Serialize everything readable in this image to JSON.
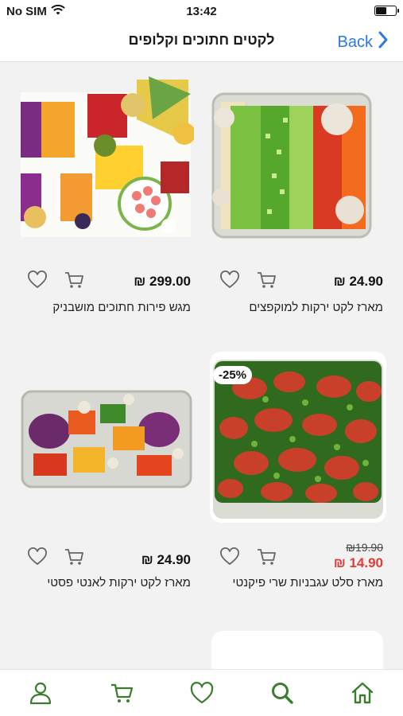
{
  "status": {
    "carrier": "No SIM",
    "time": "13:42",
    "battery_level": 0.55
  },
  "nav": {
    "title": "לקטים חתוכים וקלופים",
    "back_label": "Back"
  },
  "colors": {
    "accent_green": "#3a7d2e",
    "back_blue": "#2a7ae2",
    "sale_red": "#e53935"
  },
  "currency_symbol": "₪",
  "products": [
    {
      "name": "מארז לקט ירקות למוקפצים",
      "price": "24.90",
      "image_icon": "stirfry-vegetables-image"
    },
    {
      "name": "מגש פירות חתוכים מושבניק",
      "price": "299.00",
      "image_icon": "fruit-platter-image"
    },
    {
      "name": "מארז סלט עגבניות שרי פיקנטי",
      "price": "14.90",
      "old_price": "19.90",
      "discount": "-25%",
      "image_icon": "cherry-tomato-salad-image"
    },
    {
      "name": "מארז לקט ירקות לאנטי פסטי",
      "price": "24.90",
      "image_icon": "antipasti-vegetables-image"
    }
  ],
  "tabs": [
    {
      "icon": "user-icon"
    },
    {
      "icon": "cart-icon"
    },
    {
      "icon": "heart-icon"
    },
    {
      "icon": "search-icon"
    },
    {
      "icon": "home-icon"
    }
  ]
}
